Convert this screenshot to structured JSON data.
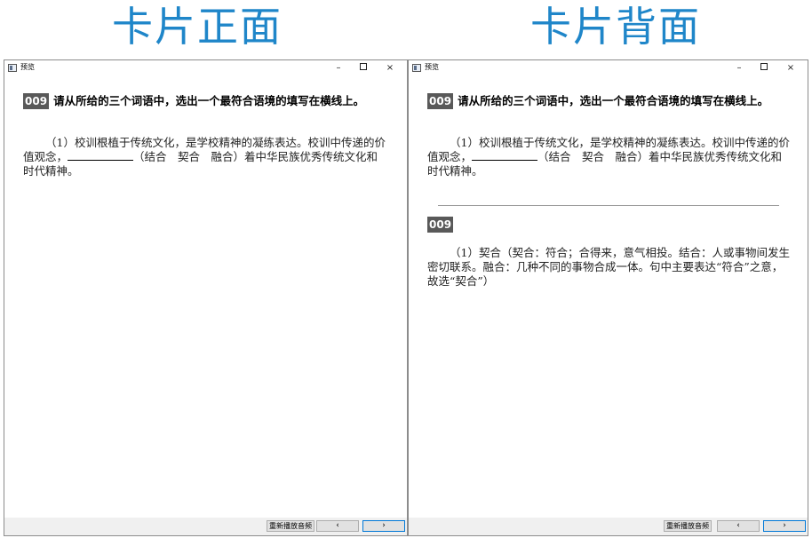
{
  "labels": {
    "front": "卡片正面",
    "back": "卡片背面"
  },
  "window": {
    "title": "预览",
    "minimize": "–",
    "close": "×"
  },
  "card": {
    "number": "009",
    "question": "请从所给的三个词语中，选出一个最符合语境的填写在横线上。",
    "sentence_part1": "（1）校训根植于传统文化，是学校精神的凝练表达。校训中传递的价值观念，",
    "sentence_part2": "（结合　契合　融合）着中华民族优秀传统文化和时代精神。",
    "answer": "（1）契合（契合：符合；合得来，意气相投。结合：人或事物间发生密切联系。融合：几种不同的事物合成一体。句中主要表达“符合”之意，故选“契合”）"
  },
  "buttons": {
    "replay": "重新播放音频",
    "prev": "‹",
    "next": "›"
  },
  "colors": {
    "title_blue": "#1f86c9",
    "badge_bg": "#595959",
    "focus_border": "#0078d7"
  }
}
